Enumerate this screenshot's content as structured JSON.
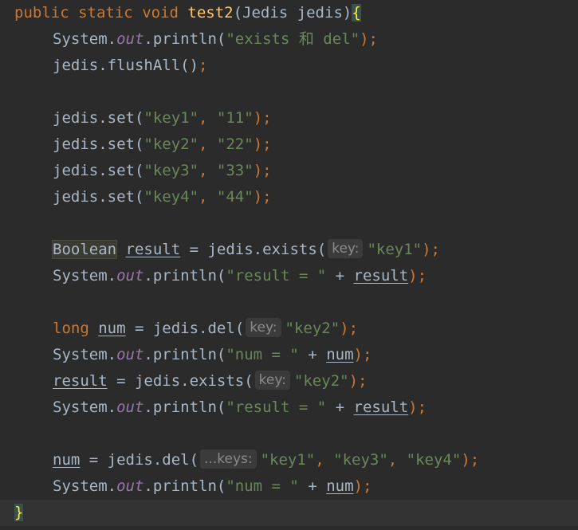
{
  "code": {
    "l1": {
      "public": "public",
      "static": "static",
      "void": "void",
      "method": "test2",
      "params": "(Jedis jedis)",
      "brace": "{"
    },
    "l2": {
      "sys": "System.",
      "out": "out",
      "call": ".println(",
      "str": "\"exists 和 del\"",
      "end": ");"
    },
    "l3": {
      "text": "jedis.flushAll()",
      "semi": ";"
    },
    "l5": {
      "pre": "jedis.set(",
      "a": "\"key1\"",
      "comma": ", ",
      "b": "\"11\"",
      "end": ");"
    },
    "l6": {
      "pre": "jedis.set(",
      "a": "\"key2\"",
      "comma": ", ",
      "b": "\"22\"",
      "end": ");"
    },
    "l7": {
      "pre": "jedis.set(",
      "a": "\"key3\"",
      "comma": ", ",
      "b": "\"33\"",
      "end": ");"
    },
    "l8": {
      "pre": "jedis.set(",
      "a": "\"key4\"",
      "comma": ", ",
      "b": "\"44\"",
      "end": ");"
    },
    "l10": {
      "type": "Boolean",
      "var": "result",
      "eq": " = jedis.exists(",
      "hint": "key:",
      "str": "\"key1\"",
      "end": ");"
    },
    "l11": {
      "sys": "System.",
      "out": "out",
      "call": ".println(",
      "str": "\"result = \"",
      "plus": " + ",
      "var": "result",
      "end": ");"
    },
    "l13": {
      "type": "long",
      "var": "num",
      "eq": " = jedis.del(",
      "hint": "key:",
      "str": "\"key2\"",
      "end": ");"
    },
    "l14": {
      "sys": "System.",
      "out": "out",
      "call": ".println(",
      "str": "\"num = \"",
      "plus": " + ",
      "var": "num",
      "end": ");"
    },
    "l15": {
      "var": "result",
      "eq": " = jedis.exists(",
      "hint": "key:",
      "str": "\"key2\"",
      "end": ");"
    },
    "l16": {
      "sys": "System.",
      "out": "out",
      "call": ".println(",
      "str": "\"result = \"",
      "plus": " + ",
      "var": "result",
      "end": ");"
    },
    "l18": {
      "var": "num",
      "eq": " = jedis.del(",
      "hint": "...keys:",
      "s1": "\"key1\"",
      "c1": ", ",
      "s2": "\"key3\"",
      "c2": ", ",
      "s3": "\"key4\"",
      "end": ");"
    },
    "l19": {
      "sys": "System.",
      "out": "out",
      "call": ".println(",
      "str": "\"num = \"",
      "plus": " + ",
      "var": "num",
      "end": ");"
    },
    "l20": {
      "brace": "}"
    }
  },
  "colors": {
    "background": "#2b2b2b",
    "keyword": "#cc7832",
    "method": "#ffc66d",
    "string": "#6a8759",
    "field": "#9876aa",
    "default": "#a9b7c6"
  }
}
